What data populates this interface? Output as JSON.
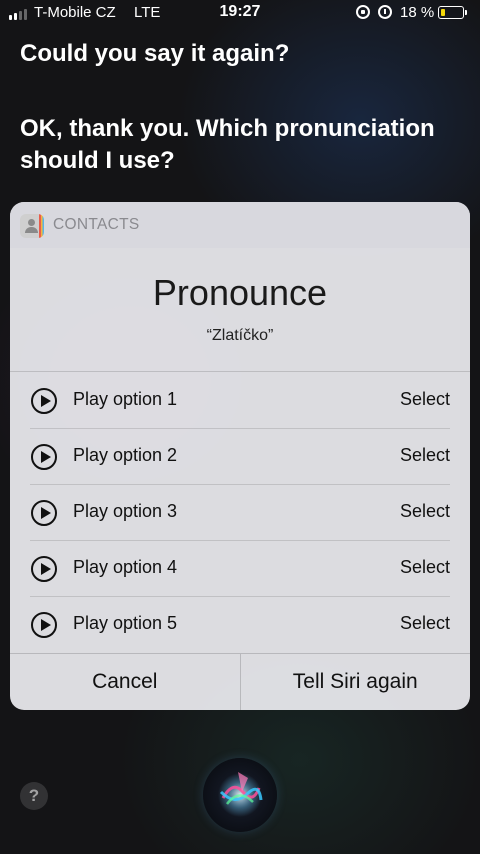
{
  "status_bar": {
    "carrier": "T-Mobile CZ",
    "network": "LTE",
    "time": "19:27",
    "battery_percent": "18 %",
    "battery_level": 0.18,
    "battery_color": "#f5d90a",
    "signal_bars_on": 2,
    "signal_bars_total": 4,
    "icons": [
      "rotation-lock-icon",
      "alarm-icon"
    ]
  },
  "siri": {
    "line1": "Could you say it again?",
    "line2": "OK, thank you. Which pronunciation should I use?"
  },
  "card": {
    "app_name": "CONTACTS",
    "app_icon": "contacts-app-icon",
    "title": "Pronounce",
    "subtitle": "“Zlatíčko”",
    "options": [
      {
        "label": "Play option 1",
        "action": "Select"
      },
      {
        "label": "Play option 2",
        "action": "Select"
      },
      {
        "label": "Play option 3",
        "action": "Select"
      },
      {
        "label": "Play option 4",
        "action": "Select"
      },
      {
        "label": "Play option 5",
        "action": "Select"
      }
    ],
    "cancel_label": "Cancel",
    "tell_again_label": "Tell Siri again"
  },
  "bottom": {
    "help_label": "?"
  }
}
